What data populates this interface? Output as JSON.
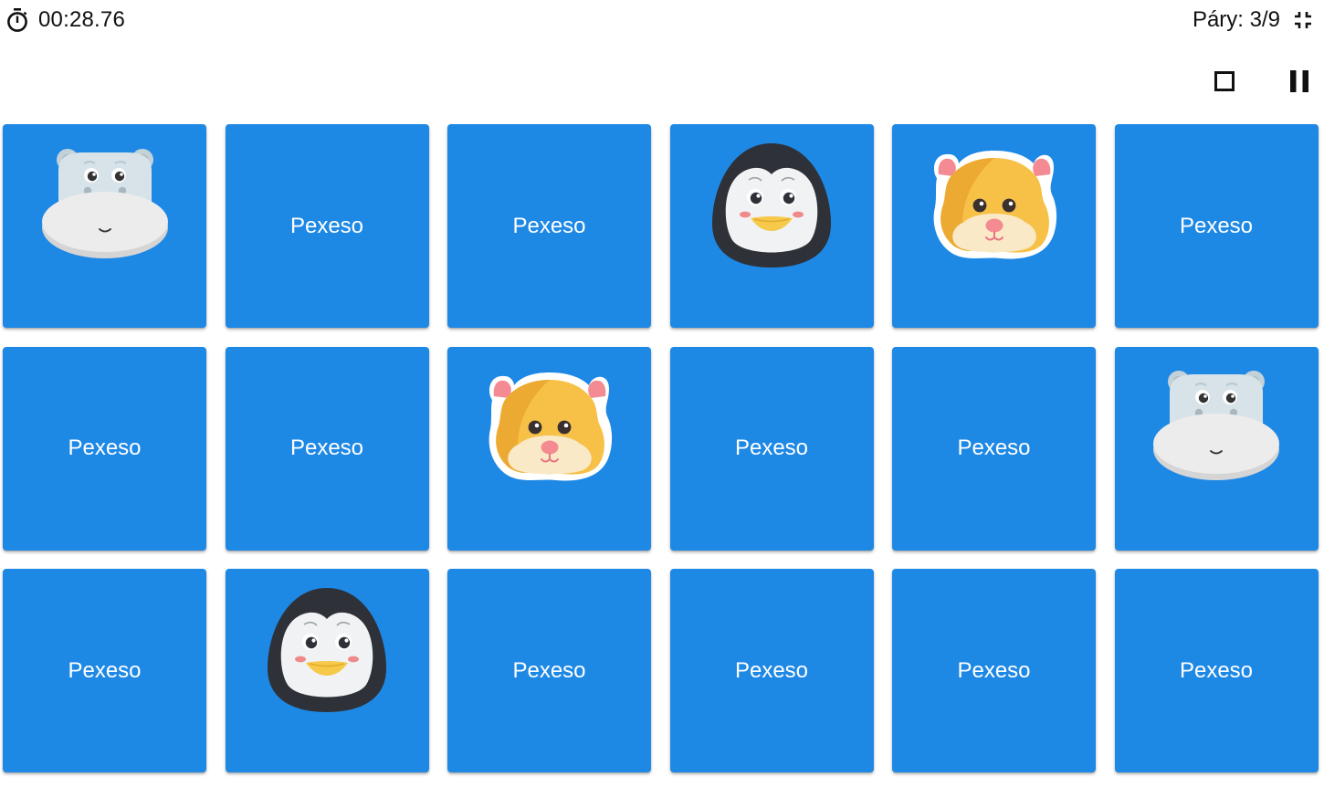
{
  "header": {
    "timer": "00:28.76",
    "pairs": "Páry: 3/9",
    "icons": {
      "timer": "stopwatch-icon",
      "fullscreen": "fullscreen-exit-icon",
      "stop": "stop-icon",
      "pause": "pause-icon"
    }
  },
  "colors": {
    "card": "#1e88e5",
    "card_text": "#ffffff"
  },
  "board": {
    "columns": 6,
    "rows": 3,
    "back_label": "Pexeso",
    "cards": [
      {
        "state": "face-up",
        "animal": "hippo"
      },
      {
        "state": "face-down"
      },
      {
        "state": "face-down"
      },
      {
        "state": "face-up",
        "animal": "penguin"
      },
      {
        "state": "face-up",
        "animal": "hamster"
      },
      {
        "state": "face-down"
      },
      {
        "state": "face-down"
      },
      {
        "state": "face-down"
      },
      {
        "state": "face-up",
        "animal": "hamster"
      },
      {
        "state": "face-down"
      },
      {
        "state": "face-down"
      },
      {
        "state": "face-up",
        "animal": "hippo"
      },
      {
        "state": "face-down"
      },
      {
        "state": "face-up",
        "animal": "penguin"
      },
      {
        "state": "face-down"
      },
      {
        "state": "face-down"
      },
      {
        "state": "face-down"
      },
      {
        "state": "face-down"
      }
    ]
  }
}
